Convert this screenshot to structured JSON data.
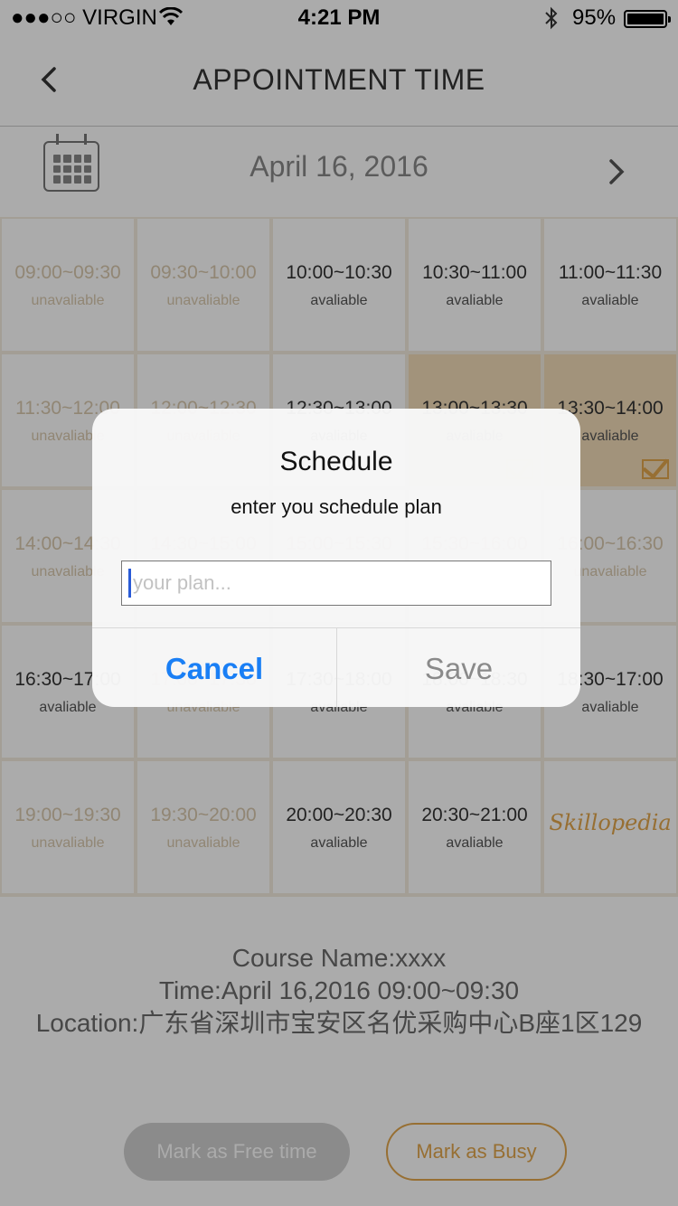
{
  "status_bar": {
    "carrier": "●●●○○ VIRGIN",
    "time": "4:21 PM",
    "battery": "95%",
    "battery_level": 0.95
  },
  "nav": {
    "back_icon": "chevron-left-icon",
    "title": "APPOINTMENT TIME"
  },
  "date_bar": {
    "calendar_icon": "calendar-icon",
    "date": "April 16, 2016",
    "next_icon": "chevron-right-icon"
  },
  "slots": [
    {
      "time": "09:00~09:30",
      "status": "unavaliable"
    },
    {
      "time": "09:30~10:00",
      "status": "unavaliable"
    },
    {
      "time": "10:00~10:30",
      "status": "avaliable"
    },
    {
      "time": "10:30~11:00",
      "status": "avaliable"
    },
    {
      "time": "11:00~11:30",
      "status": "avaliable"
    },
    {
      "time": "11:30~12:00",
      "status": "unavaliable"
    },
    {
      "time": "12:00~12:30",
      "status": "unavaliable"
    },
    {
      "time": "12:30~13:00",
      "status": "avaliable"
    },
    {
      "time": "13:00~13:30",
      "status": "avaliable"
    },
    {
      "time": "13:30~14:00",
      "status": "avaliable"
    },
    {
      "time": "14:00~14:30",
      "status": "unavaliable"
    },
    {
      "time": "14:30~15:00",
      "status": "unavaliable"
    },
    {
      "time": "15:00~15:30",
      "status": "unavaliable"
    },
    {
      "time": "15:30~16:00",
      "status": "unavaliable"
    },
    {
      "time": "16:00~16:30",
      "status": "unavaliable"
    },
    {
      "time": "16:30~17:00",
      "status": "avaliable"
    },
    {
      "time": "17:00~17:30",
      "status": "unavaliable"
    },
    {
      "time": "17:30~18:00",
      "status": "avaliable"
    },
    {
      "time": "18:00~18:30",
      "status": "avaliable"
    },
    {
      "time": "18:30~17:00",
      "status": "avaliable"
    },
    {
      "time": "19:00~19:30",
      "status": "unavaliable"
    },
    {
      "time": "19:30~20:00",
      "status": "unavaliable"
    },
    {
      "time": "20:00~20:30",
      "status": "avaliable"
    },
    {
      "time": "20:30~21:00",
      "status": "avaliable"
    }
  ],
  "logo": "Skillopedia",
  "info": {
    "course": "Course Name:xxxx",
    "time": "Time:April 16,2016 09:00~09:30",
    "location": "Location:广东省深圳市宝安区名优采购中心B座1区129"
  },
  "buttons": {
    "free": "Mark as Free time",
    "busy": "Mark as Busy"
  },
  "dialog": {
    "title": "Schedule",
    "message": "enter you schedule plan",
    "placeholder": "your plan...",
    "cancel": "Cancel",
    "save": "Save"
  },
  "colors": {
    "accent": "#e2a64c",
    "ios_blue": "#1a7ff5",
    "selected_slot": "#f2dcb8"
  }
}
